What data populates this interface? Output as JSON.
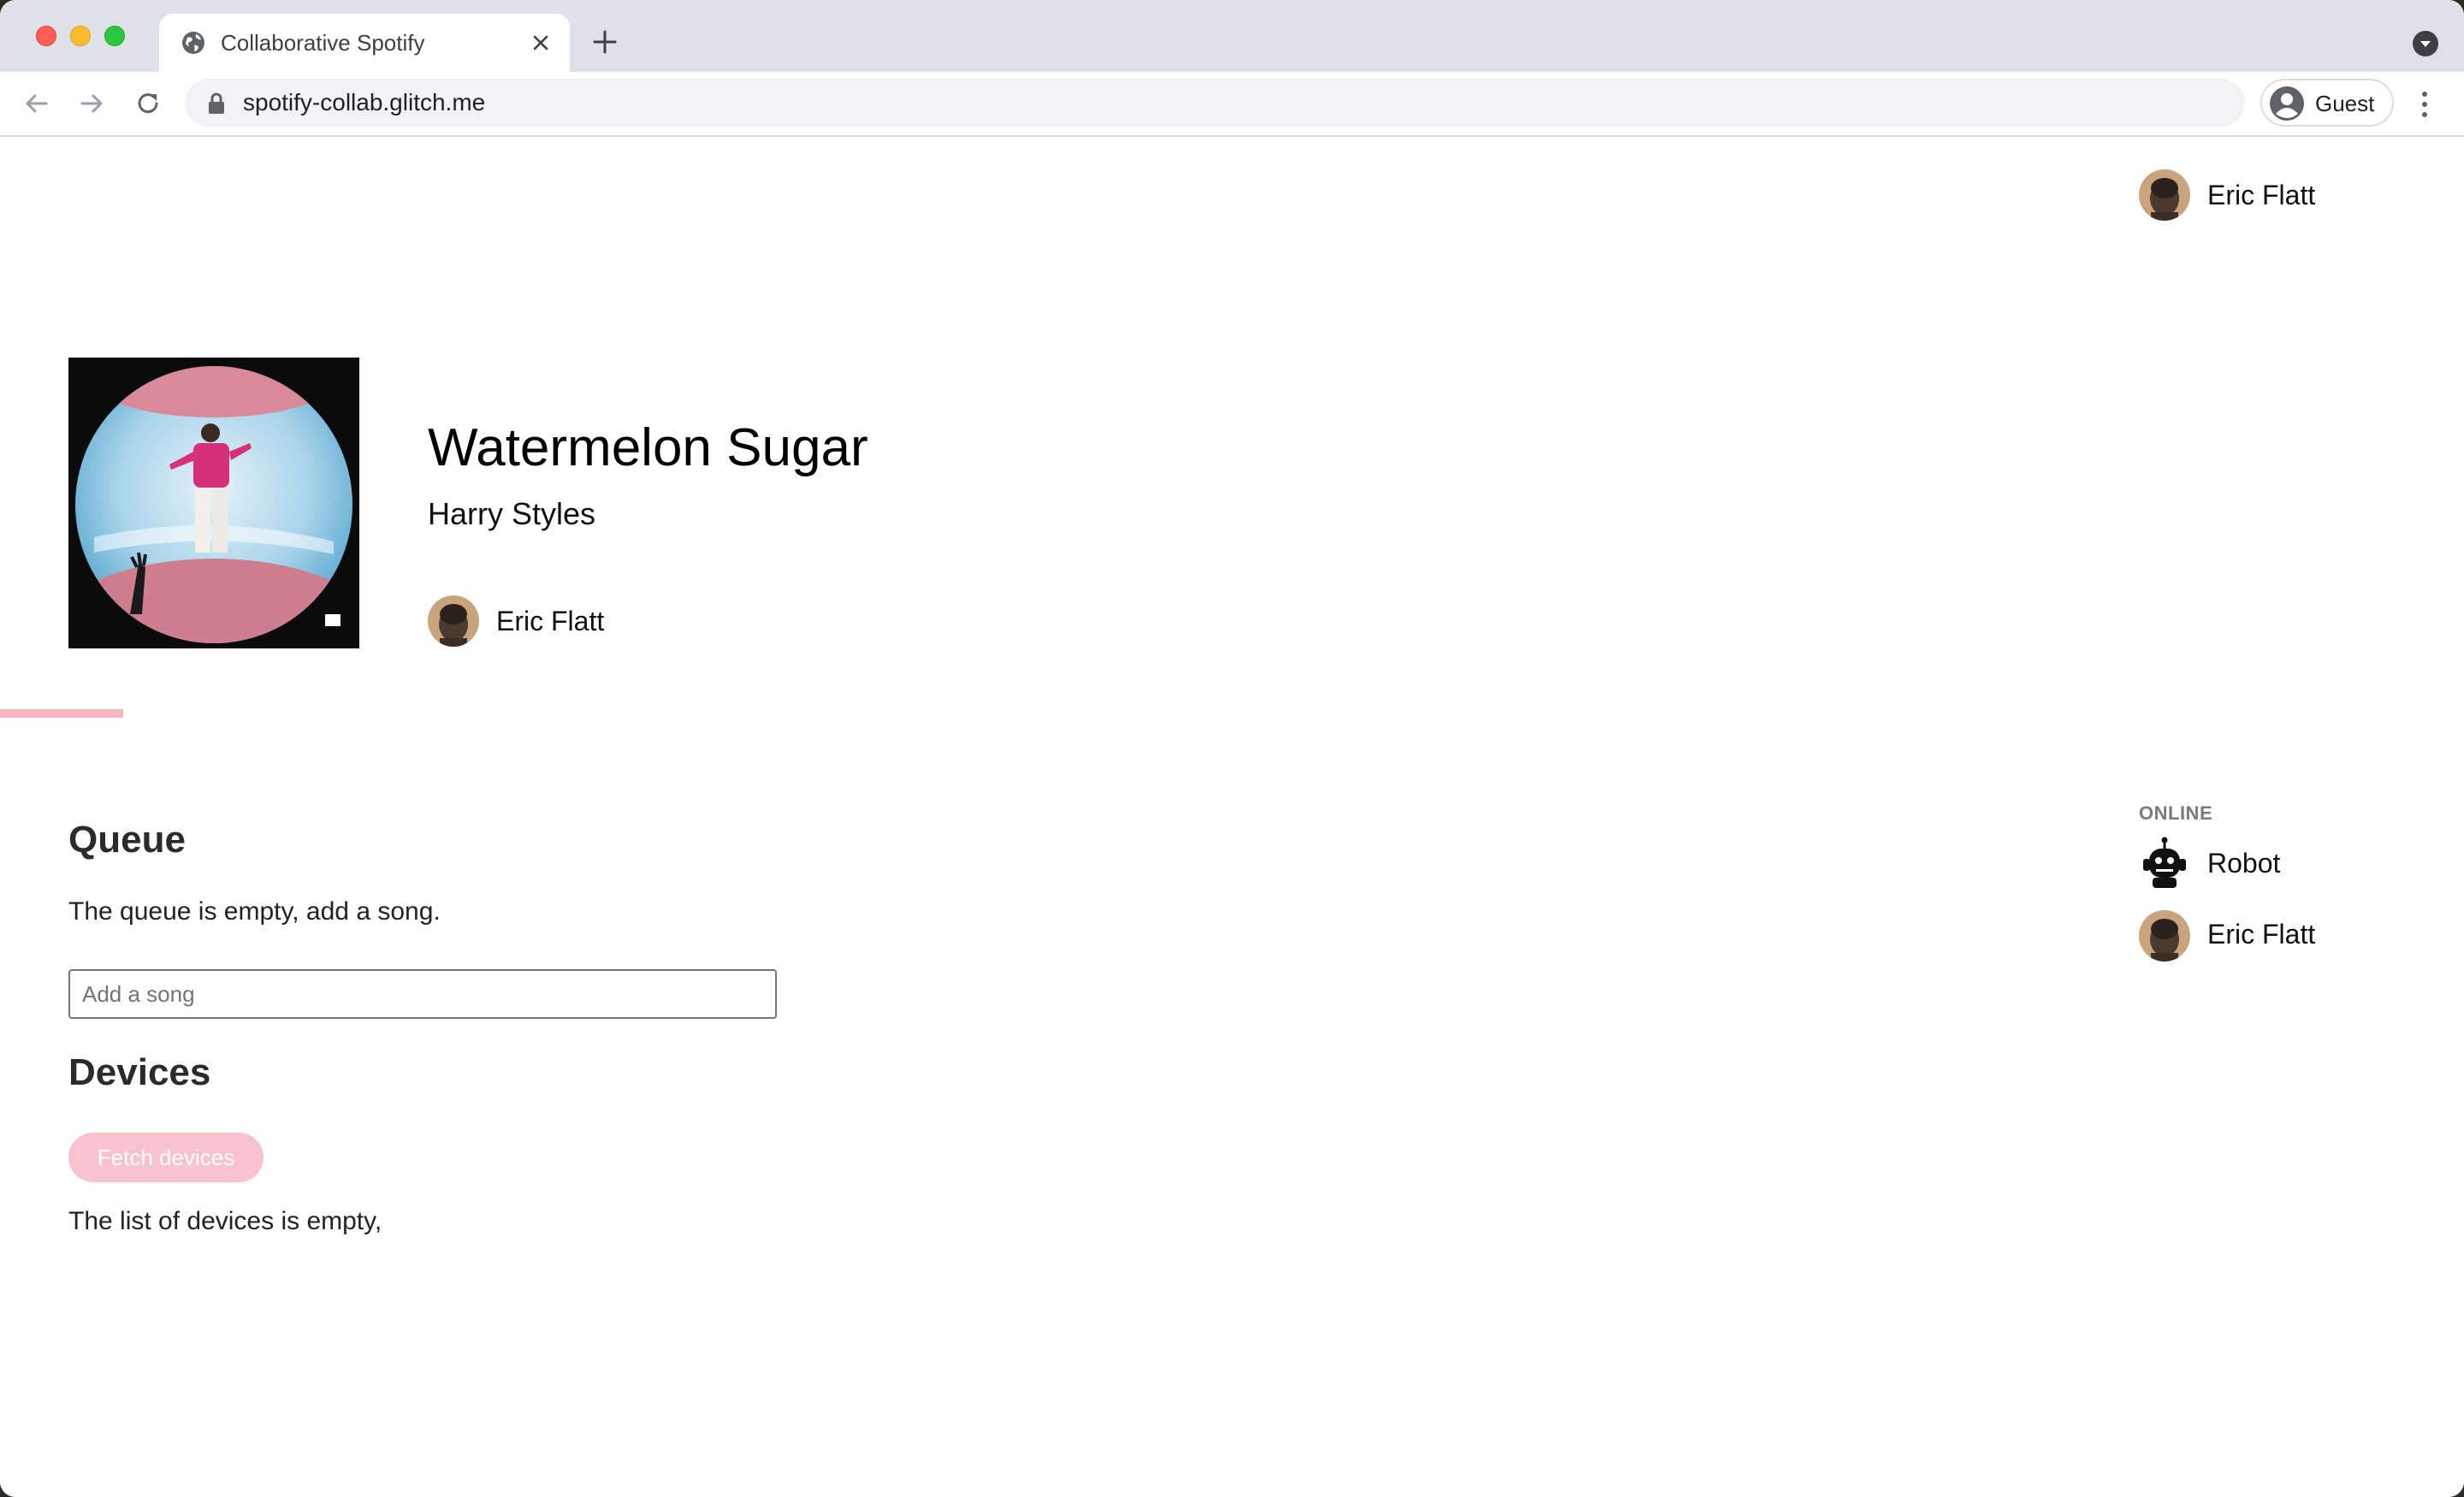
{
  "browser": {
    "tab_title": "Collaborative Spotify",
    "url": "spotify-collab.glitch.me",
    "profile_label": "Guest"
  },
  "header": {
    "user_name": "Eric Flatt"
  },
  "now_playing": {
    "title": "Watermelon Sugar",
    "artist": "Harry Styles",
    "added_by": "Eric Flatt",
    "progress_fraction": 0.05
  },
  "queue": {
    "heading": "Queue",
    "empty_text": "The queue is empty, add a song.",
    "input_placeholder": "Add a song"
  },
  "devices": {
    "heading": "Devices",
    "fetch_button_label": "Fetch devices",
    "empty_text": "The list of devices is empty,"
  },
  "online": {
    "label": "ONLINE",
    "users": [
      {
        "name": "Robot",
        "avatar": "robot-avatar"
      },
      {
        "name": "Eric Flatt",
        "avatar": "user-avatar"
      }
    ]
  },
  "colors": {
    "accent_pink": "#f8c3cc",
    "progress_pink": "#f4b8c1"
  }
}
